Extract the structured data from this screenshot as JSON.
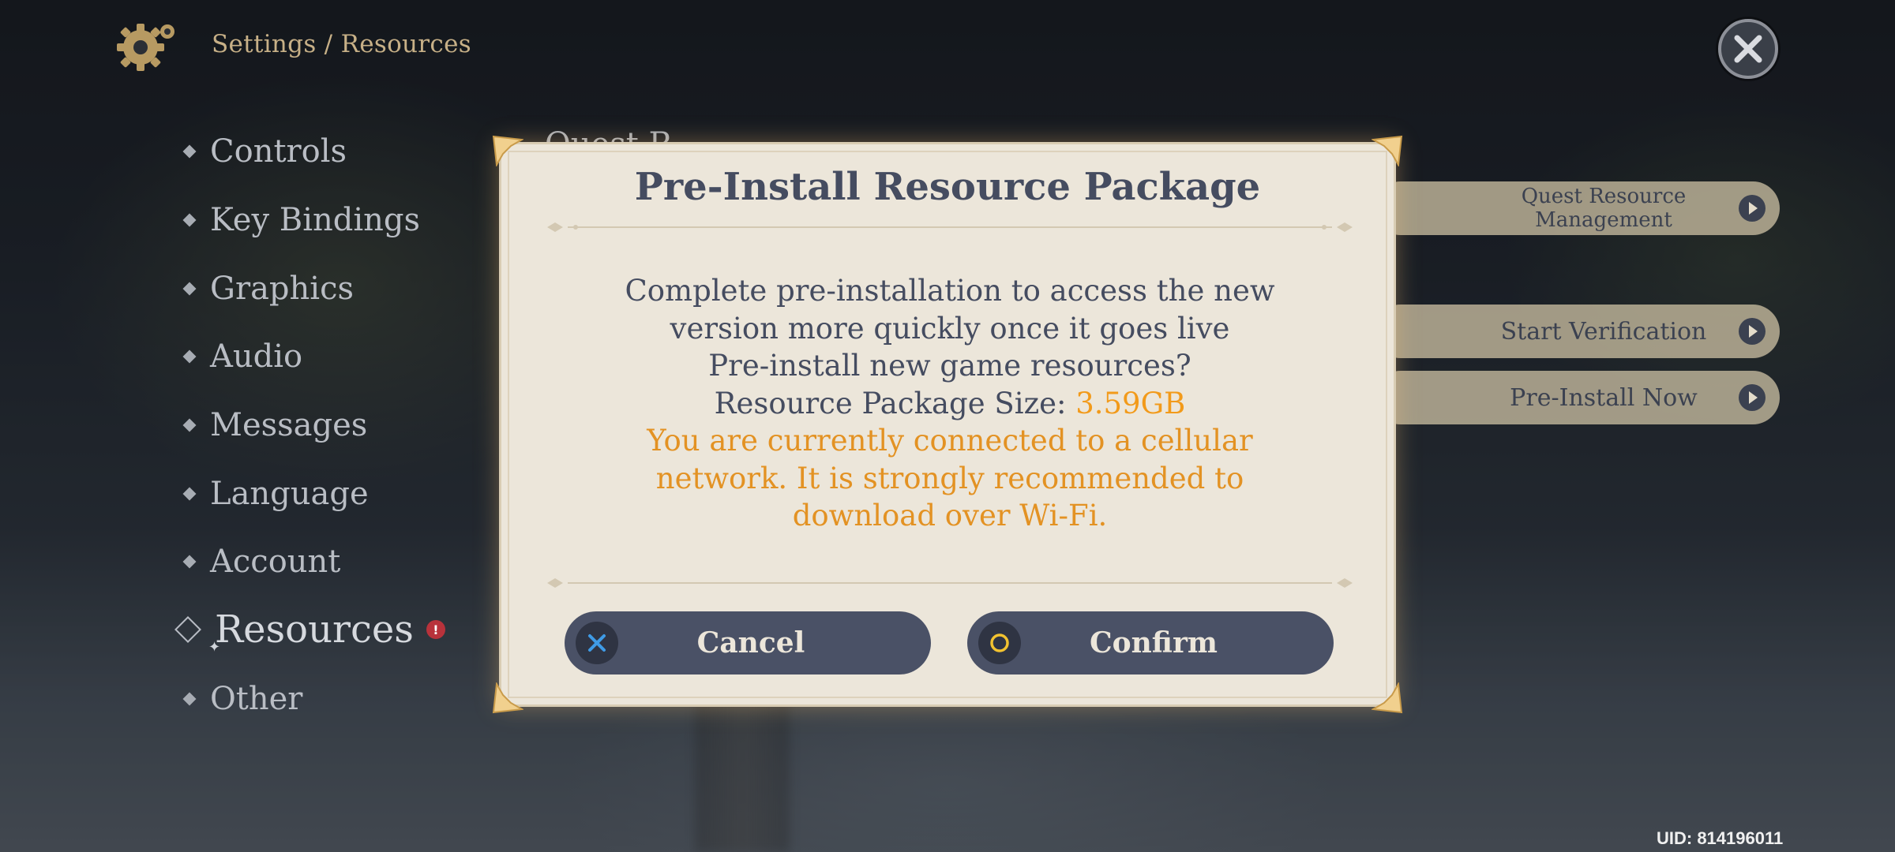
{
  "header": {
    "title": "Settings / Resources",
    "icon": "gear-icon"
  },
  "menu": {
    "items": [
      {
        "label": "Controls"
      },
      {
        "label": "Key Bindings"
      },
      {
        "label": "Graphics"
      },
      {
        "label": "Audio"
      },
      {
        "label": "Messages"
      },
      {
        "label": "Language"
      },
      {
        "label": "Account"
      },
      {
        "label": "Resources",
        "active": true,
        "alert": "!"
      },
      {
        "label": "Other"
      }
    ]
  },
  "background_panel": {
    "heading_partial": "Quest R",
    "buttons": [
      {
        "label_line1": "Quest Resource",
        "label_line2": "Management"
      },
      {
        "label": "Start Verification"
      },
      {
        "label": "Pre-Install Now"
      }
    ]
  },
  "dialog": {
    "title": "Pre-Install Resource Package",
    "line1": "Complete pre-installation to access the new",
    "line2": "version more quickly once it goes live",
    "line3": "Pre-install new game resources?",
    "size_label": "Resource Package Size: ",
    "size_value": "3.59GB",
    "warn_line1": "You are currently connected to a cellular",
    "warn_line2": "network. It is strongly recommended to",
    "warn_line3": "download over Wi-Fi.",
    "cancel_label": "Cancel",
    "confirm_label": "Confirm"
  },
  "footer": {
    "uid": "UID: 814196011"
  },
  "colors": {
    "dialog_bg": "#ece6da",
    "button_bg": "#4a5166",
    "accent_orange": "#f29a1a",
    "cancel_icon": "#3f9be6",
    "confirm_icon": "#f2c230",
    "header_text": "#c7b087"
  }
}
